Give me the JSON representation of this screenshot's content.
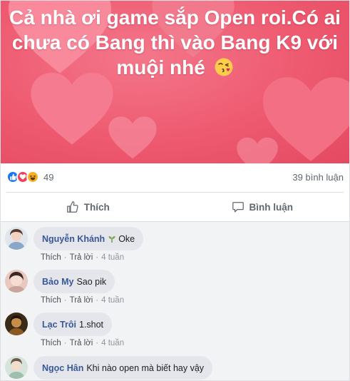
{
  "post": {
    "banner_text": "Cả nhà ơi game sắp Open roi.Có ai chưa có Bang thì vào Bang K9 với muội nhé",
    "banner_emoji": "face-blowing-kiss-emoji",
    "banner_color": "#ee5a70"
  },
  "reactions": {
    "icons": [
      "like-icon",
      "love-icon",
      "haha-icon"
    ],
    "count": "49",
    "comments_count": "39 bình luận"
  },
  "actions": {
    "like_label": "Thích",
    "comment_label": "Bình luận"
  },
  "comments": [
    {
      "name": "Nguyễn Khánh",
      "text": "Oke",
      "has_sprout": true,
      "like": "Thích",
      "reply": "Trả lời",
      "time": "4 tuần"
    },
    {
      "name": "Bảo My",
      "text": "Sao pik",
      "like": "Thích",
      "reply": "Trả lời",
      "time": "4 tuần"
    },
    {
      "name": "Lạc Trôi",
      "text": "1.shot",
      "like": "Thích",
      "reply": "Trả lời",
      "time": "4 tuần"
    },
    {
      "name": "Ngọc Hân",
      "text": "Khi nào open mà biết hay vậy",
      "like": "",
      "reply": "",
      "time": ""
    }
  ],
  "colors": {
    "name_link": "#385898",
    "like_blue": "#1877f2",
    "love_red": "#f33e58",
    "haha_yellow": "#f7b125"
  }
}
